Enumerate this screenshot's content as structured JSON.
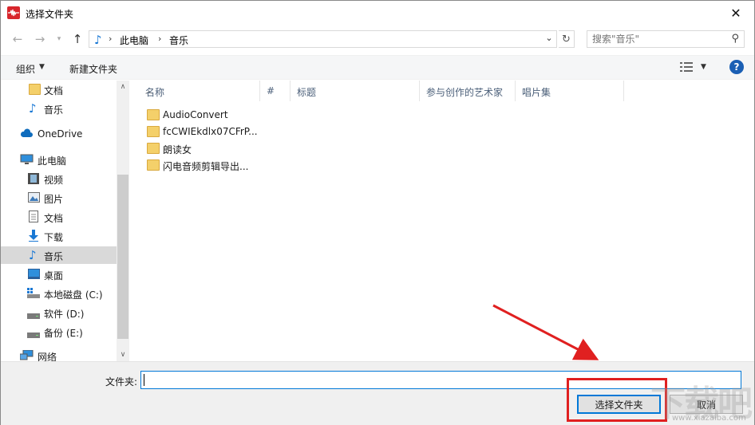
{
  "window": {
    "title": "选择文件夹",
    "close": "✕"
  },
  "address": {
    "crumbs": [
      "此电脑",
      "音乐"
    ],
    "back": "←",
    "forward": "→",
    "up": "↑",
    "refresh": "↻",
    "search_placeholder": "搜索\"音乐\""
  },
  "toolbar": {
    "organize": "组织",
    "new_folder": "新建文件夹",
    "help": "?"
  },
  "sidebar": {
    "items": [
      {
        "label": "文档",
        "icon": "folder-icon"
      },
      {
        "label": "音乐",
        "icon": "music-icon"
      },
      {
        "label": "OneDrive",
        "icon": "cloud-icon"
      },
      {
        "label": "此电脑",
        "icon": "computer-icon"
      },
      {
        "label": "视频",
        "icon": "video-icon"
      },
      {
        "label": "图片",
        "icon": "picture-icon"
      },
      {
        "label": "文档",
        "icon": "document-icon"
      },
      {
        "label": "下载",
        "icon": "download-icon"
      },
      {
        "label": "音乐",
        "icon": "music-icon",
        "selected": true
      },
      {
        "label": "桌面",
        "icon": "desktop-icon"
      },
      {
        "label": "本地磁盘 (C:)",
        "icon": "drive-c-icon"
      },
      {
        "label": "软件 (D:)",
        "icon": "drive-icon"
      },
      {
        "label": "备份 (E:)",
        "icon": "drive-icon"
      },
      {
        "label": "网络",
        "icon": "network-icon"
      }
    ]
  },
  "columns": [
    "名称",
    "#",
    "标题",
    "参与创作的艺术家",
    "唱片集"
  ],
  "files": [
    {
      "name": "AudioConvert"
    },
    {
      "name": "fcCWIEkdlx07CFrP..."
    },
    {
      "name": "朗读女"
    },
    {
      "name": "闪电音频剪辑导出..."
    }
  ],
  "footer": {
    "folder_label": "文件夹:",
    "folder_value": "",
    "select_button": "选择文件夹",
    "cancel_button": "取消"
  },
  "watermark": {
    "text": "下载吧",
    "url": "www.xiazaiba.com"
  },
  "colors": {
    "accent": "#0078d7",
    "annotation": "#e02020",
    "app_icon": "#d8262c"
  }
}
